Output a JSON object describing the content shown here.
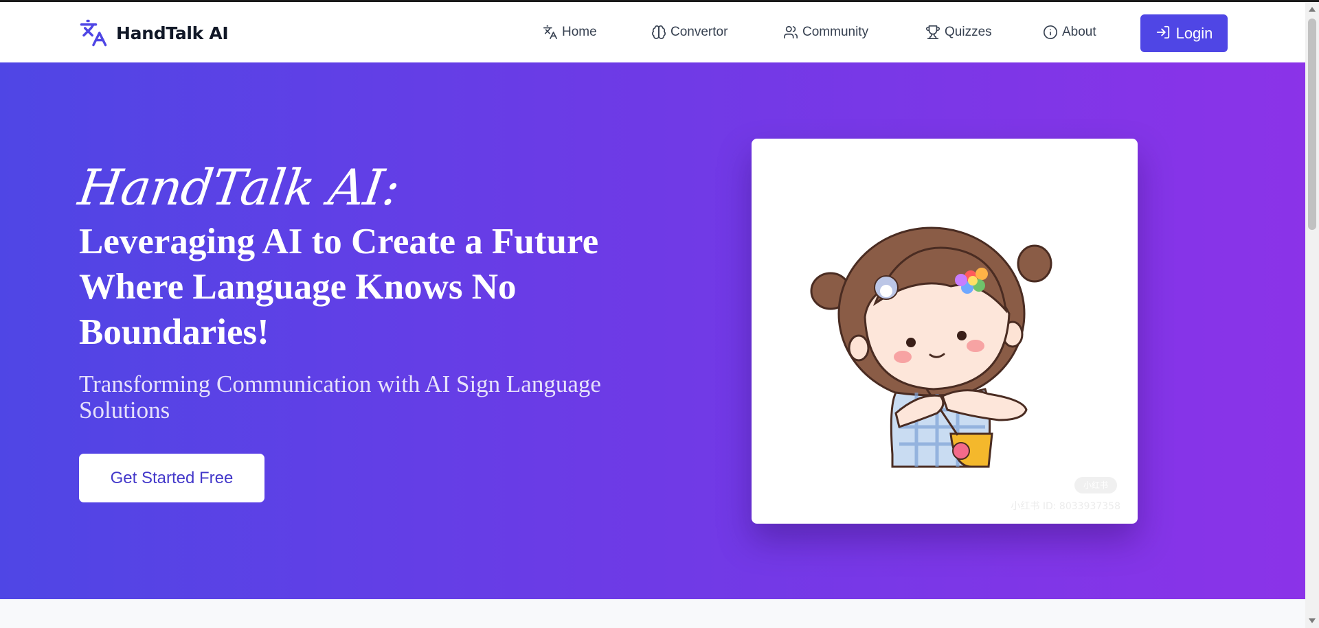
{
  "brand": {
    "name": "HandTalk AI",
    "icon": "translate-icon",
    "color": "#4f46e5"
  },
  "nav": {
    "items": [
      {
        "label": "Home",
        "icon": "translate-icon"
      },
      {
        "label": "Convertor",
        "icon": "brain-icon"
      },
      {
        "label": "Community",
        "icon": "users-icon"
      },
      {
        "label": "Quizzes",
        "icon": "trophy-icon"
      },
      {
        "label": "About",
        "icon": "info-icon"
      }
    ],
    "login_label": "Login",
    "login_icon": "login-icon"
  },
  "hero": {
    "script_title": "HandTalk AI:",
    "title": "Leveraging AI to Create a Future Where Language Knows No Boundaries!",
    "subtitle": "Transforming Communication with AI Sign Language Solutions",
    "cta_label": "Get Started Free",
    "gradient_start": "#4f46e5",
    "gradient_end": "#9333ea"
  },
  "image_card": {
    "watermark": "小红书 ID: 8033937358",
    "watermark_badge": "小红书"
  }
}
